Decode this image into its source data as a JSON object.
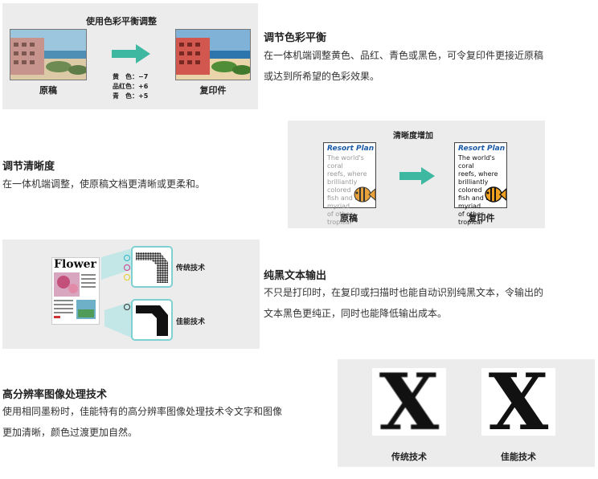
{
  "section1": {
    "panel_title": "使用色彩平衡调整",
    "original_label": "原稿",
    "copy_label": "复印件",
    "adjust_lines": [
      "黄　色：−7",
      "品红色：+6",
      "青　色：+5"
    ],
    "heading": "调节色彩平衡",
    "desc_lines": [
      "在一体机端调整黄色、品红、青色或黑色，可令复印件更接近原稿",
      "或达到所希望的色彩效果。"
    ]
  },
  "section2": {
    "heading": "调节清晰度",
    "desc": "在一体机端调整，使原稿文档更清晰或更柔和。",
    "panel_title": "清晰度增加",
    "doc_title": "Resort Plan",
    "doc_lines": [
      "The world's coral",
      "reefs, where",
      "brilliantly colored",
      "fish and a",
      "myriad",
      "of other",
      "tropical"
    ],
    "original_label": "原稿",
    "copy_label": "复印件"
  },
  "section3": {
    "heading": "纯黑文本输出",
    "desc_lines": [
      "不只是打印时，在复印或扫描时也能自动识别纯黑文本，令输出的",
      "文本黑色更纯正，同时也能降低输出成本。"
    ],
    "flower_title": "Flower",
    "label_traditional": "传统技术",
    "label_canon": "佳能技术"
  },
  "section4": {
    "heading": "高分辨率图像处理技术",
    "desc_lines": [
      "使用相同墨粉时，佳能特有的高分辨率图像处理技术令文字和图像",
      "更加清晰，颜色过渡更加自然。"
    ],
    "big_letter": "X",
    "label_traditional": "传统技术",
    "label_canon": "佳能技术"
  },
  "colors": {
    "panel": "#ececec",
    "arrow": "#3fb8a1",
    "callout": "#bfe6e6",
    "doc_title": "#1a5aa8"
  }
}
